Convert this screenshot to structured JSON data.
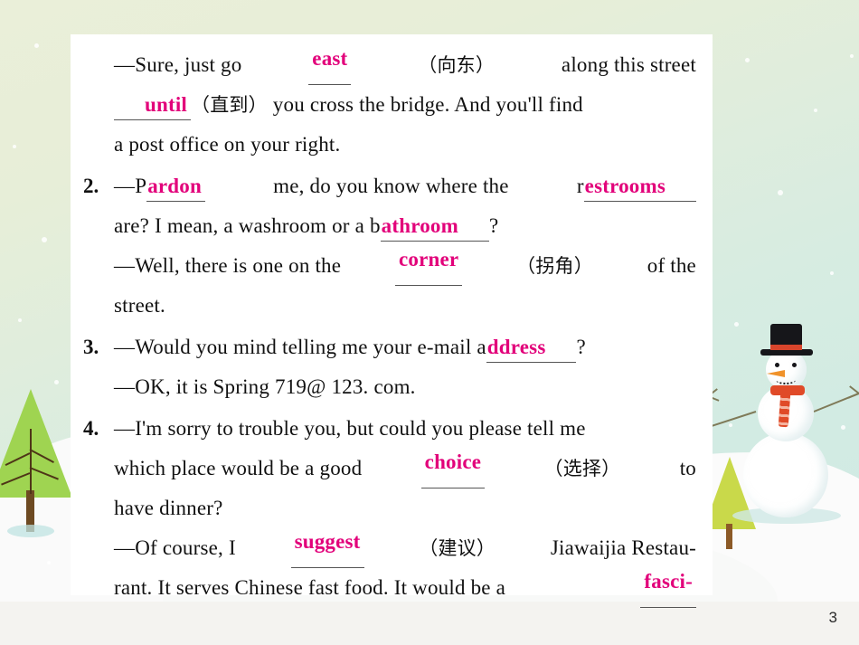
{
  "slide": {
    "page_number": "3",
    "accent_color": "#e2007a",
    "background_colors": {
      "sky_top": "#eaefd9",
      "sky_bottom": "#d0eae4",
      "snow": "#fafafa",
      "strip": "#f4f3f0"
    },
    "decorations": {
      "snowman": "snowman-illustration",
      "tree_large": "pine-tree-illustration",
      "tree_small": "pine-tree-illustration-small"
    }
  },
  "exercises": [
    {
      "number": "",
      "lines": [
        {
          "segments": [
            {
              "type": "text",
              "value": "—Sure, just go"
            },
            {
              "type": "answer",
              "value": "east"
            },
            {
              "type": "cn",
              "value": "（向东）"
            },
            {
              "type": "text",
              "value": "along this street"
            }
          ]
        },
        {
          "segments": [
            {
              "type": "answer",
              "value": "until"
            },
            {
              "type": "cn",
              "value": "（直到）"
            },
            {
              "type": "text",
              "value": "you cross the bridge. And you'll find"
            }
          ]
        },
        {
          "segments": [
            {
              "type": "text",
              "value": "a post office on your right."
            }
          ]
        }
      ]
    },
    {
      "number": "2.",
      "lines": [
        {
          "segments": [
            {
              "type": "text",
              "value": "—P"
            },
            {
              "type": "answer",
              "value": "ardon"
            },
            {
              "type": "text",
              "value": "me, do you know where the"
            },
            {
              "type": "text",
              "value": "r"
            },
            {
              "type": "answer",
              "value": "estrooms"
            }
          ]
        },
        {
          "segments": [
            {
              "type": "text",
              "value": "are?  I mean, a washroom or a b"
            },
            {
              "type": "answer",
              "value": "athroom"
            },
            {
              "type": "text",
              "value": "?"
            }
          ]
        },
        {
          "segments": [
            {
              "type": "text",
              "value": "—Well, there is one on the"
            },
            {
              "type": "answer",
              "value": "corner"
            },
            {
              "type": "cn",
              "value": "（拐角）"
            },
            {
              "type": "text",
              "value": "of the"
            }
          ]
        },
        {
          "segments": [
            {
              "type": "text",
              "value": "street."
            }
          ]
        }
      ]
    },
    {
      "number": "3.",
      "lines": [
        {
          "segments": [
            {
              "type": "text",
              "value": "—Would you mind telling me your e-mail a"
            },
            {
              "type": "answer",
              "value": "ddress"
            },
            {
              "type": "text",
              "value": "?"
            }
          ]
        },
        {
          "segments": [
            {
              "type": "text",
              "value": "—OK, it is Spring 719@ 123. com."
            }
          ]
        }
      ]
    },
    {
      "number": "4.",
      "lines": [
        {
          "segments": [
            {
              "type": "text",
              "value": "—I'm sorry to trouble you, but could you please tell me"
            }
          ]
        },
        {
          "segments": [
            {
              "type": "text",
              "value": "which place would be a good"
            },
            {
              "type": "answer",
              "value": "choice"
            },
            {
              "type": "cn",
              "value": "（选择）"
            },
            {
              "type": "text",
              "value": "to"
            }
          ]
        },
        {
          "segments": [
            {
              "type": "text",
              "value": "have dinner?"
            }
          ]
        },
        {
          "segments": [
            {
              "type": "text",
              "value": "—Of course, I"
            },
            {
              "type": "answer",
              "value": "suggest"
            },
            {
              "type": "cn",
              "value": "（建议）"
            },
            {
              "type": "text",
              "value": "Jiawaijia Restau-"
            }
          ]
        },
        {
          "segments": [
            {
              "type": "text",
              "value": "rant. It serves Chinese fast food. It would be a"
            },
            {
              "type": "answer",
              "value": "fasci-"
            }
          ]
        }
      ]
    }
  ],
  "rendered_lines": {
    "l1a": "—Sure, just go",
    "l1a_ans": "east",
    "l1a_cn": "（向东）",
    "l1a_tail": "along this street",
    "l1b_ans": "until",
    "l1b_cn": "（直到）",
    "l1b_tail": "you cross the bridge. And you'll find",
    "l1c": "a post office on your right.",
    "q2num": "2.",
    "l2a_pre": "—P",
    "l2a_ans1": "ardon",
    "l2a_mid": "me, do you know where the",
    "l2a_r": "r",
    "l2a_ans2": "estrooms",
    "l2b_pre": "are?  I mean, a washroom or a b",
    "l2b_ans": "athroom",
    "l2b_tail": "?",
    "l2c_pre": "—Well, there is one on the",
    "l2c_ans": "corner",
    "l2c_cn": "（拐角）",
    "l2c_tail": "of the",
    "l2d": "street.",
    "q3num": "3.",
    "l3a_pre": "—Would you mind telling me your e-mail a",
    "l3a_ans": "ddress",
    "l3a_tail": "?",
    "l3b": "—OK, it is Spring 719@ 123. com.",
    "q4num": "4.",
    "l4a": "—I'm sorry to trouble you, but could you please tell me",
    "l4b_pre": "which place would be a good",
    "l4b_ans": "choice",
    "l4b_cn": "（选择）",
    "l4b_tail": "to",
    "l4c": "have dinner?",
    "l4d_pre": "—Of course, I",
    "l4d_ans": "suggest",
    "l4d_cn": "（建议）",
    "l4d_tail": "Jiawaijia Restau-",
    "l4e_pre": "rant. It serves Chinese fast food. It would be a",
    "l4e_ans": "fasci-"
  }
}
